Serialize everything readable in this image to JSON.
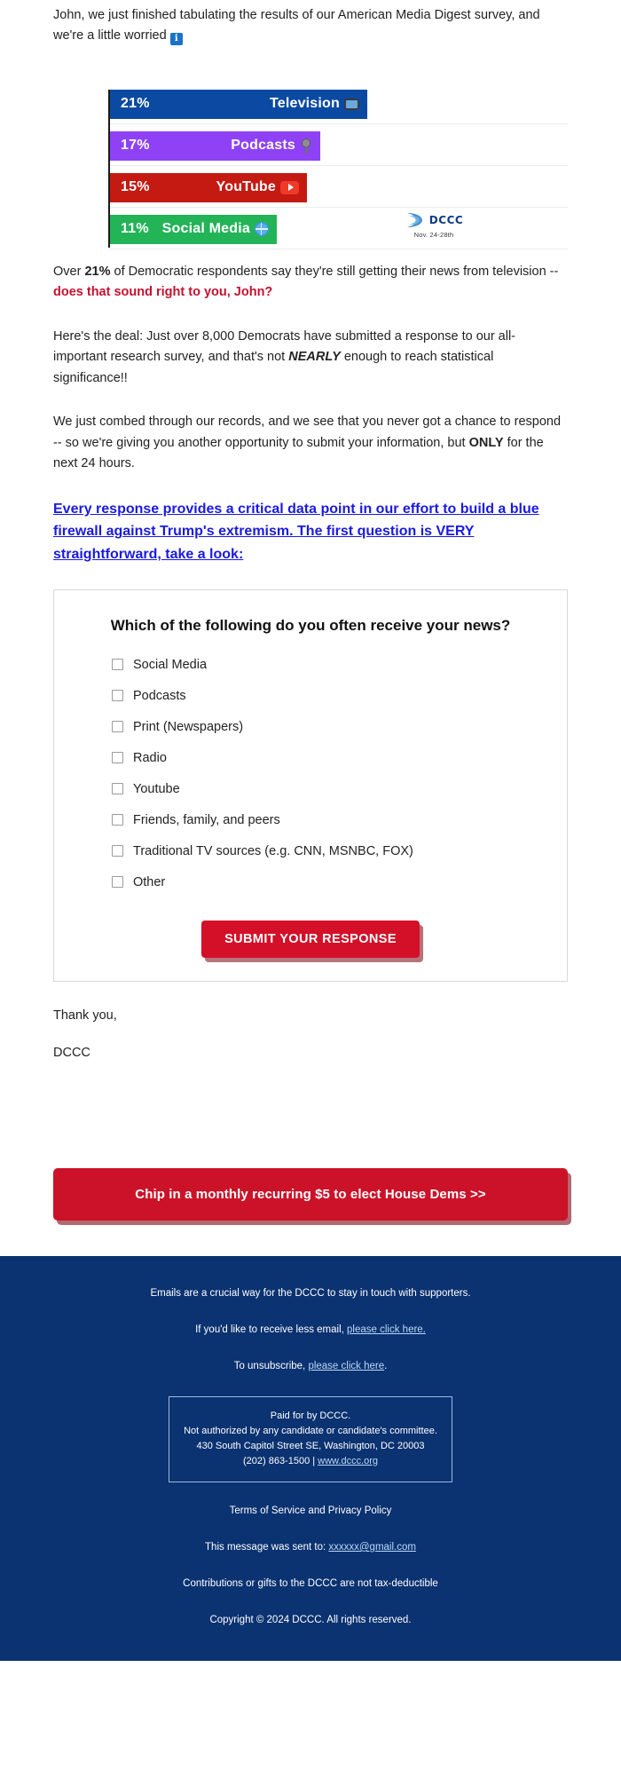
{
  "intro": {
    "text_before": "John, we just finished tabulating the results of our American Media Digest survey, and we're a little worried ",
    "emoji": "i"
  },
  "chart_data": {
    "type": "bar",
    "orientation": "horizontal",
    "title": "",
    "categories": [
      "Television",
      "Podcasts",
      "YouTube",
      "Social Media"
    ],
    "values": [
      21,
      17,
      15,
      11
    ],
    "value_labels": [
      "21%",
      "17%",
      "15%",
      "11%"
    ],
    "colors": [
      "#0b4aa2",
      "#8f42f5",
      "#c41a12",
      "#22b457"
    ],
    "icons": [
      "tv-icon",
      "microphone-icon",
      "youtube-play-icon",
      "globe-icon"
    ],
    "xlabel": "",
    "ylabel": "",
    "grid": true,
    "legend": "none",
    "logo": {
      "name": "DCCC",
      "date_range": "Nov. 24-28th"
    }
  },
  "paragraphs": {
    "p1_a": "Over ",
    "p1_b": "21%",
    "p1_c": " of Democratic respondents say they're still getting their news from television -- ",
    "p1_red": "does that sound right to you, John?",
    "p2_a": "Here's the deal: Just over 8,000 Democrats have submitted a response to our all-important research survey, and that's not ",
    "p2_em": "NEARLY",
    "p2_b": " enough to reach statistical significance!!",
    "p3_a": "We just combed through our records, and we see that you never got a chance to respond -- so we're giving you another opportunity to submit your information, but ",
    "p3_b": "ONLY",
    "p3_c": " for the next 24 hours.",
    "link_cta": "Every response provides a critical data point in our effort to build a blue firewall against Trump's extremism. The first question is VERY straightforward, take a look:"
  },
  "survey": {
    "question": "Which of the following do you often receive your news?",
    "options": [
      "Social Media",
      "Podcasts",
      "Print (Newspapers)",
      "Radio",
      "Youtube",
      "Friends, family, and peers",
      "Traditional TV sources (e.g. CNN, MSNBC, FOX)",
      "Other"
    ],
    "submit_label": "SUBMIT YOUR RESPONSE"
  },
  "signoff": {
    "thanks": "Thank you,",
    "name": "DCCC"
  },
  "chip_button": {
    "label": "Chip in a monthly recurring $5 to elect House Dems >>"
  },
  "footer": {
    "line1": "Emails are a crucial way for the DCCC to stay in touch with supporters.",
    "line2_pre": "If you'd like to receive less email, ",
    "line2_link": "please click here.",
    "line3_pre": "To unsubscribe, ",
    "line3_link": "please click here",
    "line3_post": ".",
    "paid_line1": "Paid for by DCCC.",
    "paid_line2": "Not authorized by any candidate or candidate's committee.",
    "paid_line3": "430 South Capitol Street SE, Washington, DC 20003",
    "paid_line4_pre": "(202) 863-1500 | ",
    "paid_line4_link": "www.dccc.org",
    "terms": "Terms of Service and Privacy Policy",
    "sent_to_pre": "This message was sent to: ",
    "sent_to_link": "xxxxxx@gmail.com",
    "tax": "Contributions or gifts to the DCCC are not tax-deductible",
    "copyright": "Copyright © 2024 DCCC. All rights reserved."
  },
  "colors": {
    "footer_bg": "#0b3271",
    "accent_red": "#c41230",
    "cta_red": "#cc1228",
    "link_blue": "#1a1ae0"
  }
}
